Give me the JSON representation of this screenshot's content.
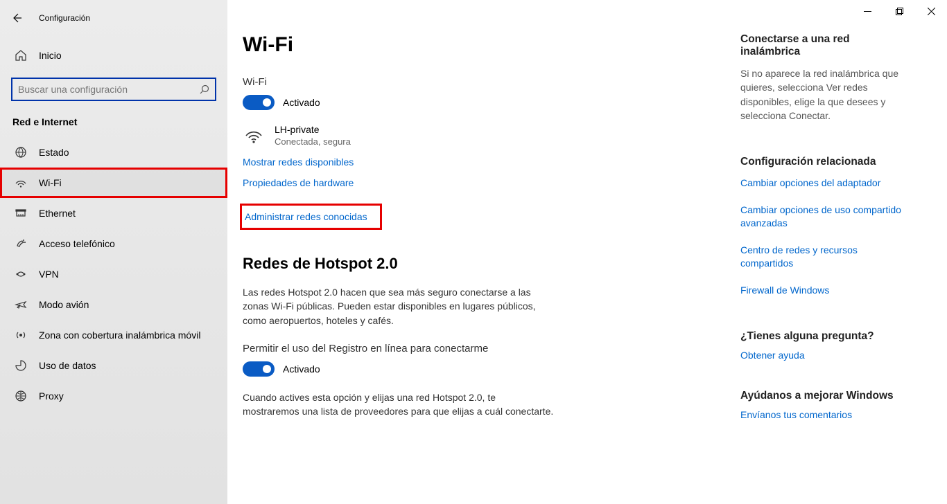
{
  "app_title": "Configuración",
  "home_label": "Inicio",
  "search_placeholder": "Buscar una configuración",
  "category_label": "Red e Internet",
  "nav": [
    {
      "label": "Estado"
    },
    {
      "label": "Wi-Fi"
    },
    {
      "label": "Ethernet"
    },
    {
      "label": "Acceso telefónico"
    },
    {
      "label": "VPN"
    },
    {
      "label": "Modo avión"
    },
    {
      "label": "Zona con cobertura inalámbrica móvil"
    },
    {
      "label": "Uso de datos"
    },
    {
      "label": "Proxy"
    }
  ],
  "page": {
    "title": "Wi-Fi",
    "wifi_label": "Wi-Fi",
    "toggle_on": "Activado",
    "net_name": "LH-private",
    "net_status": "Conectada, segura",
    "link_show_networks": "Mostrar redes disponibles",
    "link_hw_props": "Propiedades de hardware",
    "link_manage_known": "Administrar redes conocidas",
    "hotspot_title": "Redes de Hotspot 2.0",
    "hotspot_para": "Las redes Hotspot 2.0 hacen que sea más seguro conectarse a las zonas Wi-Fi públicas. Pueden estar disponibles en lugares públicos, como aeropuertos, hoteles y cafés.",
    "hotspot_permit": "Permitir el uso del Registro en línea para conectarme",
    "hotspot_toggle_on": "Activado",
    "hotspot_para2": "Cuando actives esta opción y elijas una red Hotspot 2.0, te mostraremos una lista de proveedores para que elijas a cuál conectarte."
  },
  "right": {
    "connect_title": "Conectarse a una red inalámbrica",
    "connect_text": "Si no aparece la red inalámbrica que quieres, selecciona Ver redes disponibles, elige la que desees y selecciona Conectar.",
    "related_title": "Configuración relacionada",
    "related_links": {
      "adapter": "Cambiar opciones del adaptador",
      "sharing": "Cambiar opciones de uso compartido avanzadas",
      "netcenter": "Centro de redes y recursos compartidos",
      "firewall": "Firewall de Windows"
    },
    "help_title": "¿Tienes alguna pregunta?",
    "help_link": "Obtener ayuda",
    "feedback_title": "Ayúdanos a mejorar Windows",
    "feedback_link": "Envíanos tus comentarios"
  }
}
